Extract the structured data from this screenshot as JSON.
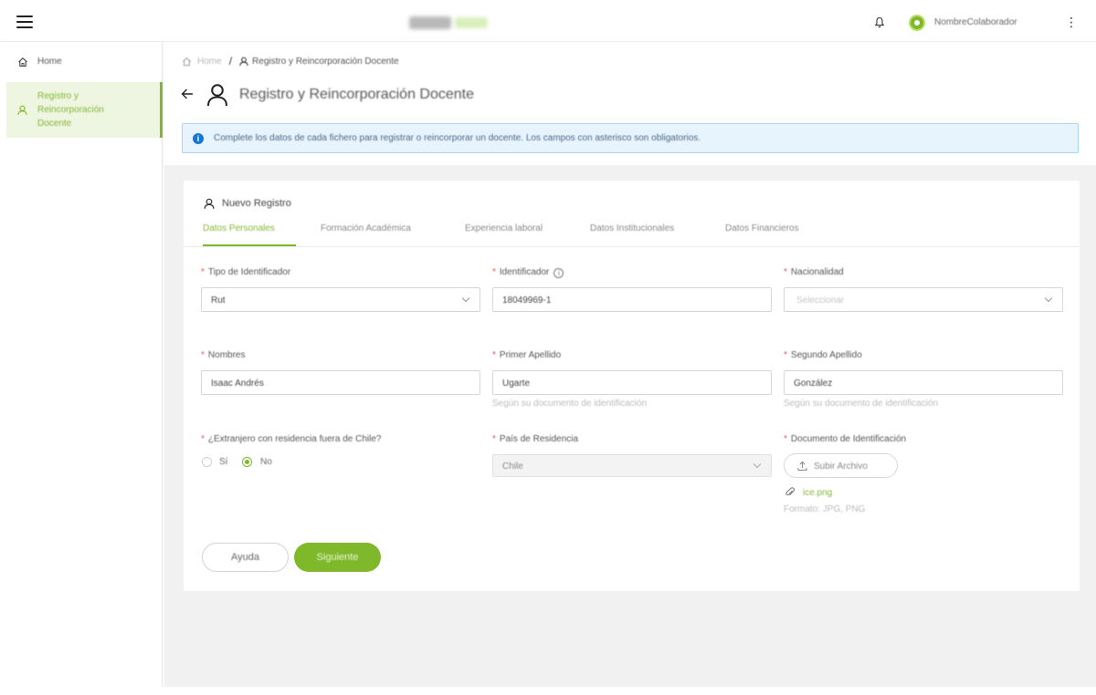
{
  "topbar": {
    "username": "NombreColaborador"
  },
  "sidebar": {
    "items": [
      {
        "label": "Home",
        "icon": "home-icon"
      },
      {
        "label": "Registro y Reincorporación Docente",
        "icon": "user-icon"
      }
    ]
  },
  "breadcrumb": {
    "home": "Home",
    "separator": "/",
    "current": "Registro y Reincorporación Docente"
  },
  "page": {
    "title": "Registro y Reincorporación Docente",
    "info": "Complete los datos de cada fichero para registrar o reincorporar un docente. Los campos con asterisco son obligatorios."
  },
  "card": {
    "title": "Nuevo Registro",
    "tabs": [
      {
        "label": "Datos Personales",
        "active": true
      },
      {
        "label": "Formación Académica",
        "active": false
      },
      {
        "label": "Experiencia laboral",
        "active": false
      },
      {
        "label": "Datos Institucionales",
        "active": false
      },
      {
        "label": "Datos Financieros",
        "active": false
      }
    ]
  },
  "form": {
    "required_mark": "*",
    "tipo_identificador": {
      "label": "Tipo de Identificador",
      "value": "Rut"
    },
    "identificador": {
      "label": "Identificador",
      "value": "18049969-1"
    },
    "nacionalidad": {
      "label": "Nacionalidad",
      "placeholder": "Seleccionar"
    },
    "nombres": {
      "label": "Nombres",
      "value": "Isaac Andrés"
    },
    "primer_apellido": {
      "label": "Primer Apellido",
      "value": "Ugarte",
      "help": "Según su documento de identificación"
    },
    "segundo_apellido": {
      "label": "Segundo Apellido",
      "value": "González",
      "help": "Según su documento de identificación"
    },
    "extranjero": {
      "label": "¿Extranjero con residencia fuera de Chile?",
      "options": [
        "Sí",
        "No"
      ],
      "selected": "No"
    },
    "pais_residencia": {
      "label": "País de Residencia",
      "value": "Chile"
    },
    "documento": {
      "label": "Documento de Identificación",
      "button": "Subir Archivo",
      "file": "ice.png",
      "formats": "Formato: JPG, PNG"
    }
  },
  "actions": {
    "help": "Ayuda",
    "next": "Siguiente"
  },
  "colors": {
    "accent": "#7fb82a",
    "info_bg": "#e8f4fd",
    "required": "#e34b4b"
  }
}
